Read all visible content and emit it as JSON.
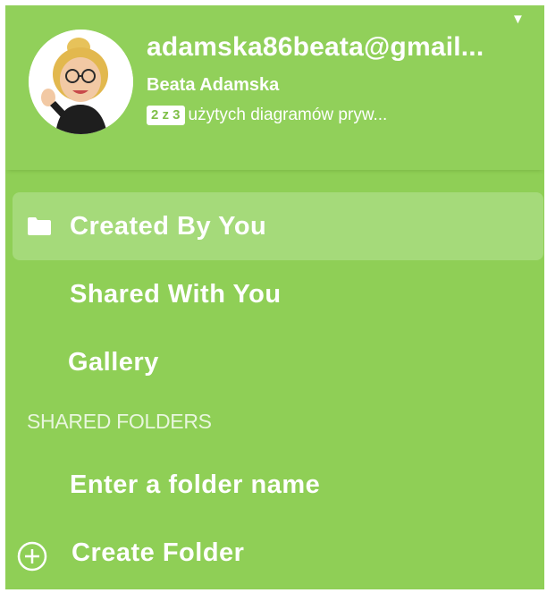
{
  "account": {
    "email": "adamska86beata@gmail...",
    "name": "Beata Adamska",
    "quota_badge": "2 z 3",
    "quota_text": "użytych diagramów pryw..."
  },
  "nav": {
    "created_by_you": "Created By You",
    "shared_with_you": "Shared With You",
    "gallery": "Gallery"
  },
  "shared_folders": {
    "title": "SHARED FOLDERS",
    "folder_name": "Enter a folder name",
    "create_folder": "Create Folder"
  },
  "icons": {
    "account_menu": "caret-down-icon",
    "created_by_you": "folder-icon",
    "create_folder": "plus-circle-icon"
  },
  "colors": {
    "panel": "#8fcf56",
    "active_item": "#a5da7a",
    "text": "#ffffff"
  }
}
